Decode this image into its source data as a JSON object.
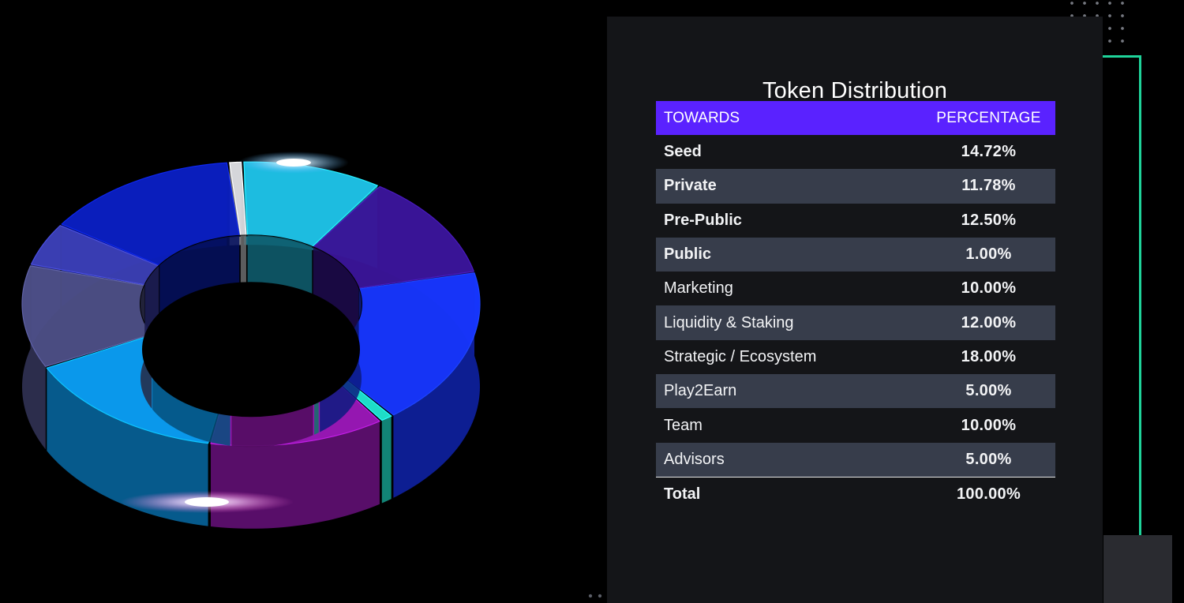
{
  "chart_data": {
    "type": "pie",
    "style": "3d-donut",
    "title": "Token Distribution",
    "table": {
      "headers": [
        "TOWARDS",
        "PERCENTAGE"
      ],
      "rows": [
        {
          "label": "Seed",
          "value": "14.72%"
        },
        {
          "label": "Private",
          "value": "11.78%"
        },
        {
          "label": "Pre-Public",
          "value": "12.50%"
        },
        {
          "label": "Public",
          "value": "1.00%"
        },
        {
          "label": "Marketing",
          "value": "10.00%"
        },
        {
          "label": "Liquidity & Staking",
          "value": "12.00%"
        },
        {
          "label": "Strategic / Ecosystem",
          "value": "18.00%"
        },
        {
          "label": "Play2Earn",
          "value": "5.00%"
        },
        {
          "label": "Team",
          "value": "10.00%"
        },
        {
          "label": "Advisors",
          "value": "5.00%"
        }
      ],
      "total": {
        "label": "Total",
        "value": "100.00%"
      }
    },
    "slices": [
      {
        "value": 1.0,
        "color": "#d8dade"
      },
      {
        "value": 10.0,
        "color": "#1ec0e4"
      },
      {
        "value": 12.0,
        "color": "#3a1599"
      },
      {
        "value": 18.0,
        "color": "#1736ff"
      },
      {
        "value": 1.0,
        "color": "#1fe6cf"
      },
      {
        "value": 12.5,
        "color": "#9b18b8"
      },
      {
        "value": 14.72,
        "color": "#0a9ef5"
      },
      {
        "value": 11.78,
        "color": "#4d4f86"
      },
      {
        "value": 5.0,
        "color": "#3b3fb5"
      },
      {
        "value": 14.0,
        "color": "#0a1fc0"
      }
    ]
  }
}
